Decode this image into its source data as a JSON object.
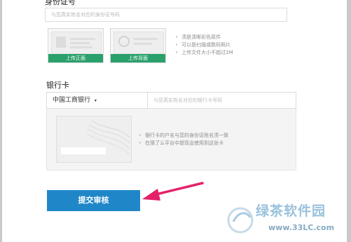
{
  "id_section": {
    "title": "身份证号",
    "id_placeholder": "与您真实姓名对应的身份证号码",
    "front_upload_label": "上传正面",
    "back_upload_label": "上传背面",
    "hints": [
      "须是清晰彩色原件",
      "可以是扫描或数码照片",
      "上传文件大小不超过2M"
    ]
  },
  "bank_section": {
    "title": "银行卡",
    "bank_select_value": "中国工商银行",
    "card_number_placeholder": "与您真实姓名对应的银行卡号码",
    "hints": [
      "银行卡的户名与您的身份证姓名须一致",
      "在猜了么平台中提现会使用到这张卡"
    ]
  },
  "submit_label": "提交审核",
  "watermark": {
    "name": "绿茶软件园",
    "url": "www.33LC.com"
  },
  "colors": {
    "green": "#2aa06b",
    "blue": "#1f87c8",
    "arrow": "#e3226a"
  }
}
